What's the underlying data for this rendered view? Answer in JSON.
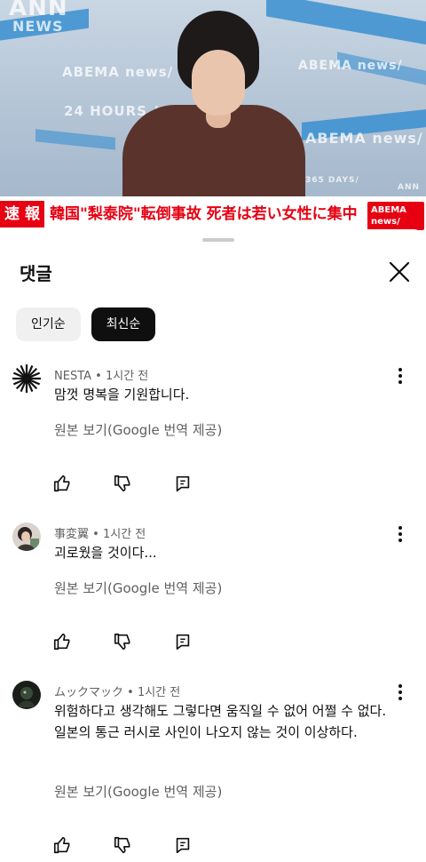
{
  "video": {
    "watermark_ann": "ANN",
    "watermark_news": "NEWS",
    "watermark_abema1": "ABEMA news/",
    "watermark_abema2": "ABEMA news/",
    "watermark_abema3": "ABEMA news/",
    "watermark_24h": "24 HOURS /",
    "watermark_365": "365 DAYS/",
    "ticker_tag": "速 報",
    "ticker_text": "韓国\"梨泰院\"転倒事故 死者は若い女性に集中",
    "ticker_logo": "ABEMA news/",
    "corner_mark": "ANN"
  },
  "sheet": {
    "title": "댓글",
    "chips": [
      "인기순",
      "최신순"
    ],
    "active_chip": "최신순"
  },
  "comments": [
    {
      "author": "NESTA",
      "time": "1시간 전",
      "text": "맘껏 명복을 기원합니다.",
      "translate": "원본 보기(Google 번역 제공)"
    },
    {
      "author": "事変翼",
      "time": "1시간 전",
      "text": "괴로웠을 것이다...",
      "translate": "원본 보기(Google 번역 제공)"
    },
    {
      "author": "ムックマック",
      "time": "1시간 전",
      "text": "위험하다고 생각해도 그렇다면 움직일 수 없어 어쩔 수 없다. 일본의 통근 러시로 사인이 나오지 않는 것이 이상하다.",
      "translate": "원본 보기(Google 번역 제공)"
    }
  ],
  "meta_sep": "•",
  "colors": {
    "accent_red": "#e60012",
    "chip_active": "#0f0f0f",
    "secondary_text": "#606060"
  },
  "icons": [
    "close-icon",
    "like-icon",
    "dislike-icon",
    "reply-icon",
    "more-vert-icon"
  ]
}
